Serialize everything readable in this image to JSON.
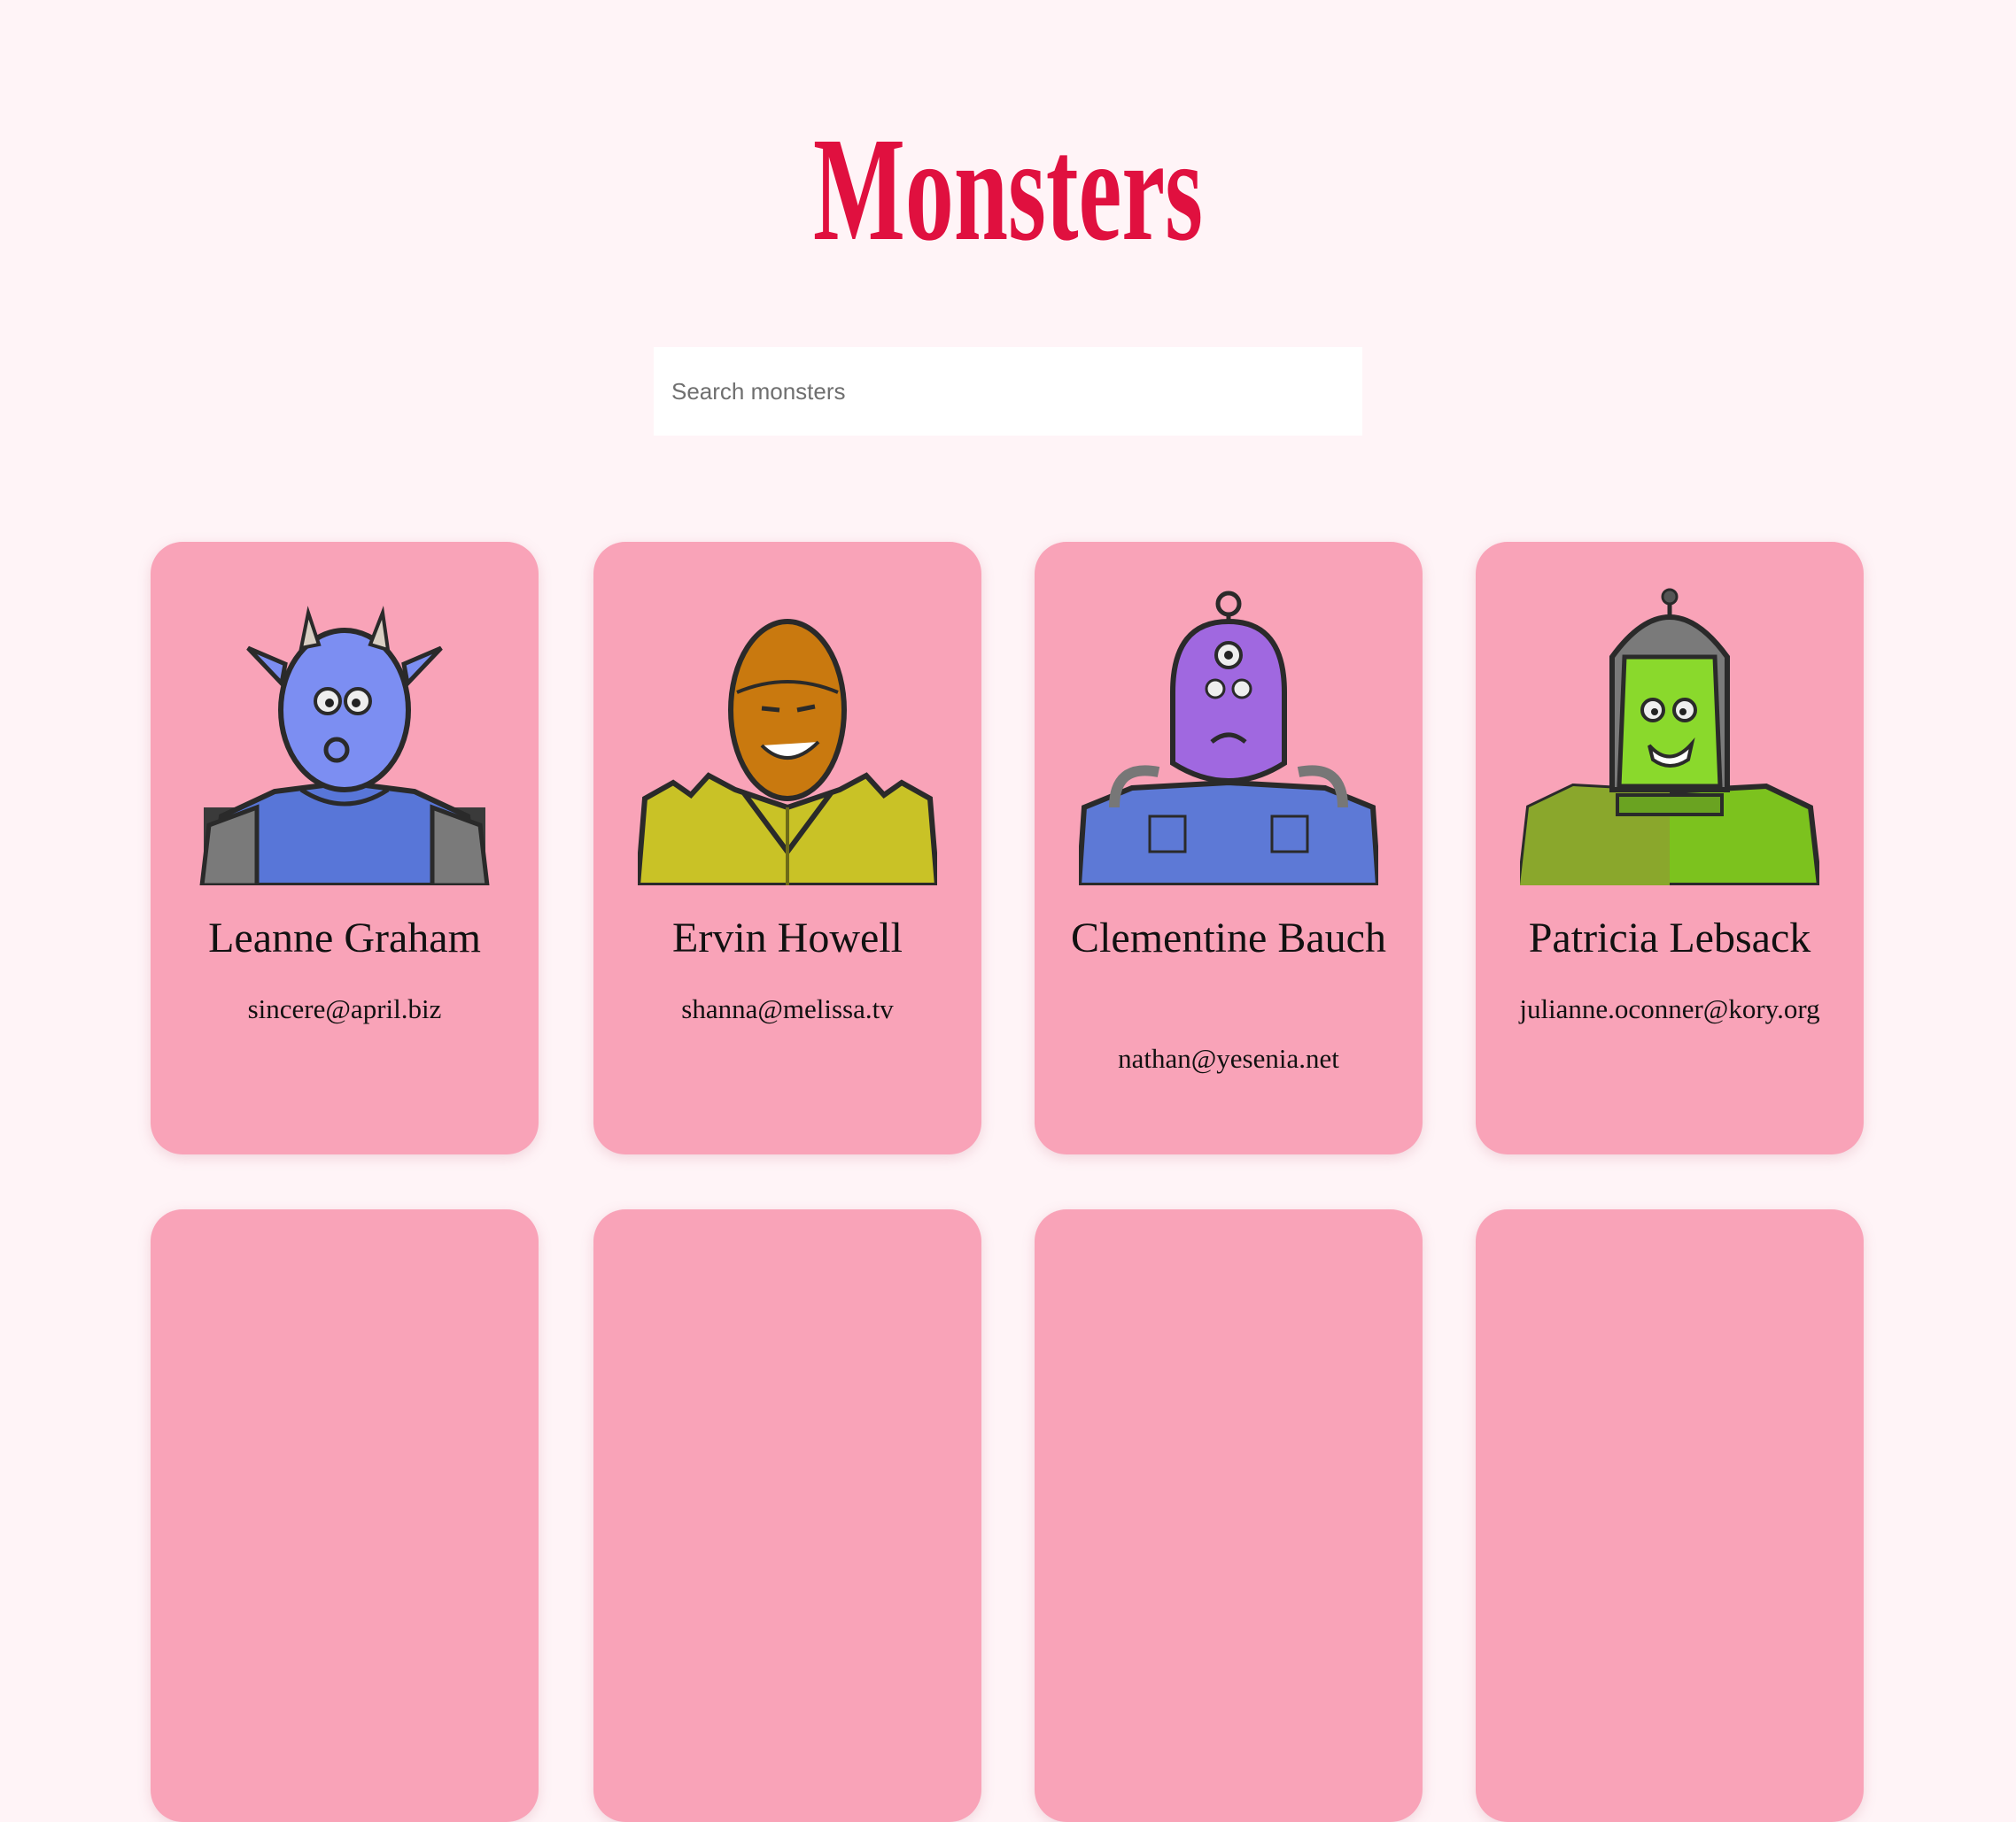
{
  "header": {
    "logo_text": "Monsters",
    "logo_color": "#e0103f"
  },
  "search": {
    "placeholder": "Search monsters",
    "value": ""
  },
  "colors": {
    "page_background": "#fff4f7",
    "card_background": "#f9a3b8"
  },
  "monsters": [
    {
      "name": "Leanne Graham",
      "email": "sincere@april.biz",
      "icon": "blue-horned-monster"
    },
    {
      "name": "Ervin Howell",
      "email": "shanna@melissa.tv",
      "icon": "orange-masked-monster"
    },
    {
      "name": "Clementine Bauch",
      "email": "nathan@yesenia.net",
      "icon": "purple-cyclops-robot"
    },
    {
      "name": "Patricia Lebsack",
      "email": "julianne.oconner@kory.org",
      "icon": "green-helmet-monster"
    }
  ]
}
